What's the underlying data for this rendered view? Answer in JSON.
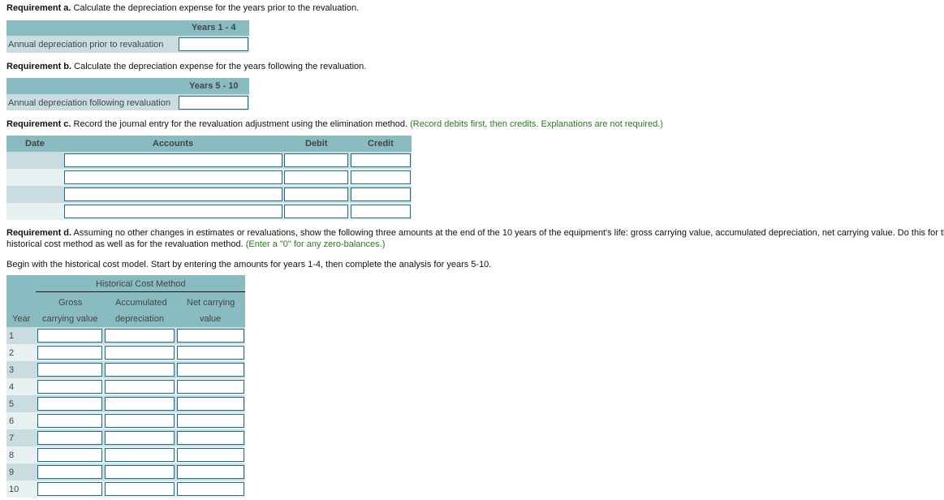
{
  "req_a": {
    "heading": "Requirement a.",
    "text": " Calculate the depreciation expense for the years prior to the revaluation.",
    "column_header": "Years 1 - 4",
    "row_label": "Annual depreciation prior to revaluation",
    "value": ""
  },
  "req_b": {
    "heading": "Requirement b.",
    "text": " Calculate the depreciation expense for the years following the revaluation.",
    "column_header": "Years 5 - 10",
    "row_label": "Annual depreciation following revaluation",
    "value": ""
  },
  "req_c": {
    "heading": "Requirement c.",
    "text": " Record the journal entry for the revaluation adjustment using the elimination method.",
    "note": " (Record debits first, then credits. Explanations are not required.)",
    "columns": {
      "date": "Date",
      "accounts": "Accounts",
      "debit": "Debit",
      "credit": "Credit"
    },
    "rows": [
      {
        "date": "",
        "account": "",
        "debit": "",
        "credit": ""
      },
      {
        "date": "",
        "account": "",
        "debit": "",
        "credit": ""
      },
      {
        "date": "",
        "account": "",
        "debit": "",
        "credit": ""
      },
      {
        "date": "",
        "account": "",
        "debit": "",
        "credit": ""
      }
    ]
  },
  "req_d": {
    "heading": "Requirement d.",
    "text_line1": " Assuming no other changes in estimates or revaluations, show the following three amounts at the end of the 10 years of the equipment's life: gross carrying value, accumulated depreciation, net carrying value. Do this for the",
    "text_line2": "historical cost method as well as for the revaluation method.",
    "note": " (Enter a \"0\" for any zero-balances.)",
    "instruction": "Begin with the historical cost model. Start by entering the amounts for years 1-4, then complete the analysis for years 5-10.",
    "table": {
      "group_header": "Historical Cost Method",
      "year_header": "Year",
      "col1_line1": "Gross",
      "col1_line2": "carrying value",
      "col2_line1": "Accumulated",
      "col2_line2": "depreciation",
      "col3_line1": "Net carrying",
      "col3_line2": "value",
      "rows": [
        {
          "year": "1",
          "gross": "",
          "accum": "",
          "net": ""
        },
        {
          "year": "2",
          "gross": "",
          "accum": "",
          "net": ""
        },
        {
          "year": "3",
          "gross": "",
          "accum": "",
          "net": ""
        },
        {
          "year": "4",
          "gross": "",
          "accum": "",
          "net": ""
        },
        {
          "year": "5",
          "gross": "",
          "accum": "",
          "net": ""
        },
        {
          "year": "6",
          "gross": "",
          "accum": "",
          "net": ""
        },
        {
          "year": "7",
          "gross": "",
          "accum": "",
          "net": ""
        },
        {
          "year": "8",
          "gross": "",
          "accum": "",
          "net": ""
        },
        {
          "year": "9",
          "gross": "",
          "accum": "",
          "net": ""
        },
        {
          "year": "10",
          "gross": "",
          "accum": "",
          "net": ""
        }
      ]
    }
  }
}
